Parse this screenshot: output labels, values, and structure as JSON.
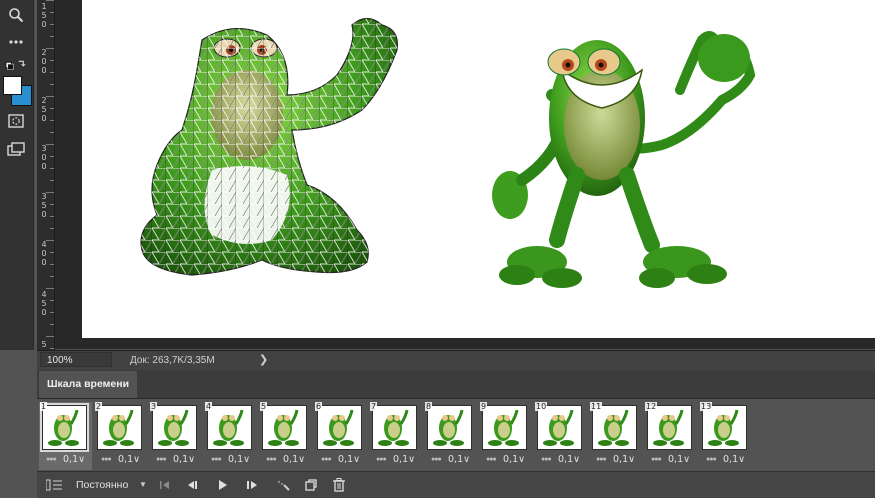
{
  "toolbar": {
    "tools": [
      "zoom-tool",
      "more-tools",
      "swap-colors",
      "quick-mask",
      "screen-mode"
    ],
    "foreground_color": "#ffffff",
    "background_color": "#2a8fd0"
  },
  "ruler": {
    "labels": [
      "150",
      "200",
      "250",
      "300",
      "350",
      "400",
      "450",
      "500"
    ]
  },
  "status": {
    "zoom": "100%",
    "doc": "Док: 263,7K/3,35M",
    "arrow": "❯"
  },
  "timeline": {
    "tab_label": "Шкала времени",
    "frames": [
      {
        "num": "1",
        "delay": "0,1",
        "selected": true
      },
      {
        "num": "2",
        "delay": "0,1"
      },
      {
        "num": "3",
        "delay": "0,1"
      },
      {
        "num": "4",
        "delay": "0,1"
      },
      {
        "num": "5",
        "delay": "0,1"
      },
      {
        "num": "6",
        "delay": "0,1"
      },
      {
        "num": "7",
        "delay": "0,1"
      },
      {
        "num": "8",
        "delay": "0,1"
      },
      {
        "num": "9",
        "delay": "0,1"
      },
      {
        "num": "10",
        "delay": "0,1"
      },
      {
        "num": "11",
        "delay": "0,1"
      },
      {
        "num": "12",
        "delay": "0,1"
      },
      {
        "num": "13",
        "delay": "0,1"
      }
    ],
    "loop_option": "Постоянно"
  }
}
